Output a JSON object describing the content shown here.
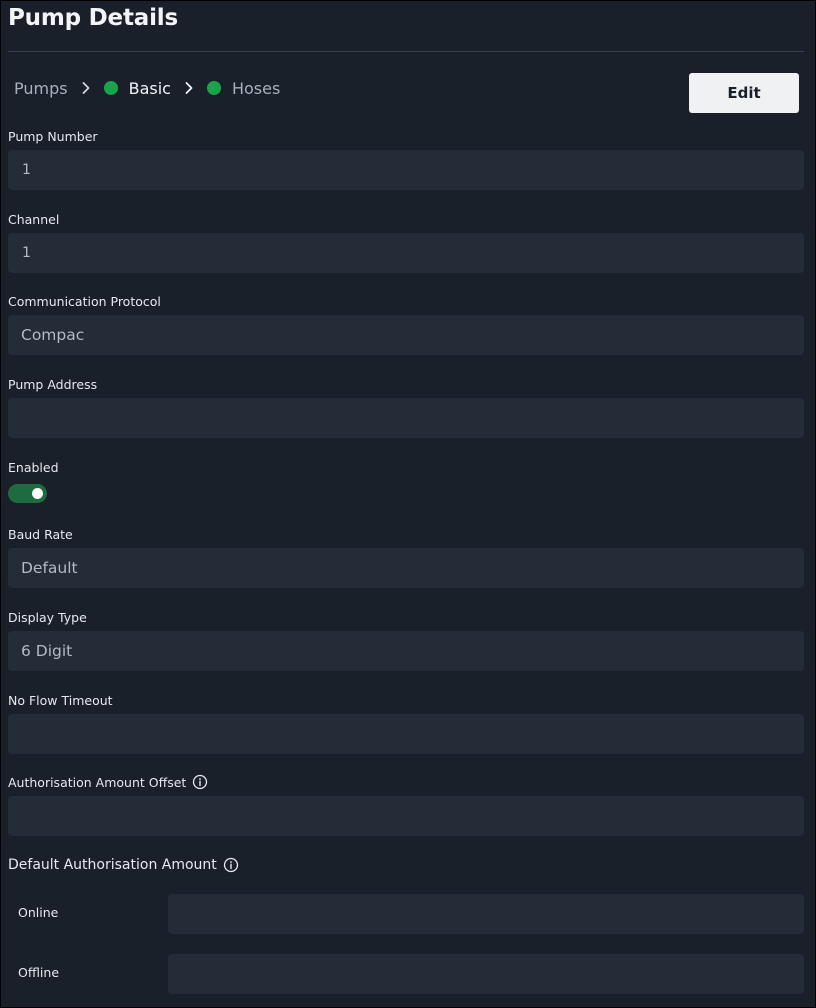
{
  "page": {
    "title": "Pump Details"
  },
  "breadcrumb": {
    "items": [
      {
        "label": "Pumps",
        "dot": false,
        "active": false
      },
      {
        "label": "Basic",
        "dot": true,
        "active": true
      },
      {
        "label": "Hoses",
        "dot": true,
        "active": false
      }
    ]
  },
  "toolbar": {
    "edit_label": "Edit"
  },
  "colors": {
    "accent_green": "#1aa34a",
    "toggle_on": "#1e6b3f",
    "background": "#1a202a",
    "field_bg": "#242c37"
  },
  "form": {
    "pump_number": {
      "label": "Pump Number",
      "value": "1"
    },
    "channel": {
      "label": "Channel",
      "value": "1"
    },
    "communication_protocol": {
      "label": "Communication Protocol",
      "value": "Compac"
    },
    "pump_address": {
      "label": "Pump Address",
      "value": ""
    },
    "enabled": {
      "label": "Enabled",
      "value": true
    },
    "baud_rate": {
      "label": "Baud Rate",
      "value": "Default"
    },
    "display_type": {
      "label": "Display Type",
      "value": "6 Digit"
    },
    "no_flow_timeout": {
      "label": "No Flow Timeout",
      "value": ""
    },
    "authorisation_amount_offset": {
      "label": "Authorisation Amount Offset",
      "value": "",
      "icon": "info-icon"
    },
    "default_authorisation_amount": {
      "label": "Default Authorisation Amount",
      "icon": "info-icon",
      "online": {
        "label": "Online",
        "value": ""
      },
      "offline": {
        "label": "Offline",
        "value": ""
      }
    }
  }
}
